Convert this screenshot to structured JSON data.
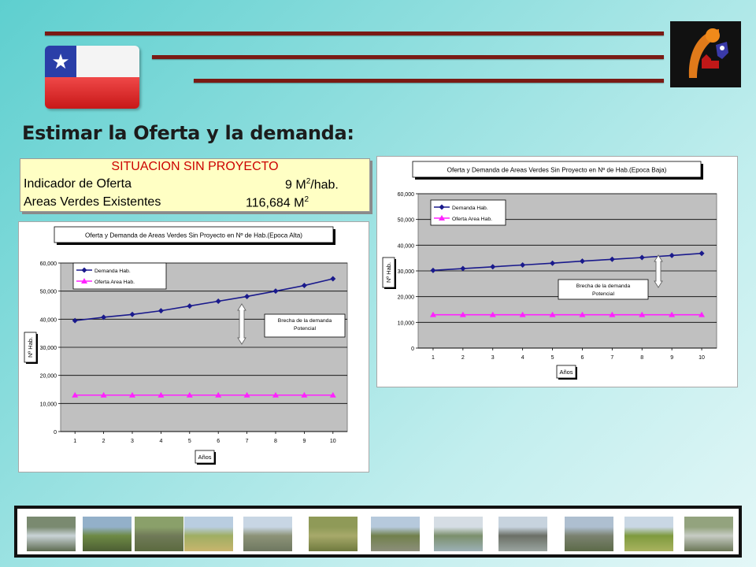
{
  "slide": {
    "title": "Estimar la Oferta y la demanda:",
    "flag": {
      "star": "★",
      "colors": [
        "#2a3ea8",
        "#f4f4f4",
        "#d82020"
      ]
    },
    "logo": {
      "icon": "institution-logo-icon"
    }
  },
  "info_box": {
    "heading": "SITUACION SIN PROYECTO",
    "rows": [
      {
        "label": "Indicador de Oferta",
        "value": "9",
        "unit_base": "M",
        "unit_sup": "2",
        "unit_suffix": "/hab."
      },
      {
        "label": "Areas Verdes Existentes",
        "value": "116,684",
        "unit_base": "M",
        "unit_sup": "2",
        "unit_suffix": ""
      }
    ]
  },
  "chart_data": [
    {
      "type": "line",
      "title": "Oferta y Demanda de Areas Verdes Sin Proyecto en Nº de Hab.(Epoca Alta)",
      "xlabel": "Años",
      "ylabel": "Nº Hab.",
      "x": [
        1,
        2,
        3,
        4,
        5,
        6,
        7,
        8,
        9,
        10
      ],
      "ylim": [
        0,
        60000
      ],
      "yticks": [
        "0",
        "10,000",
        "20,000",
        "30,000",
        "40,000",
        "50,000",
        "60,000"
      ],
      "grid": true,
      "legend": "top-left",
      "annotation": [
        "Brecha de la demanda",
        "Potencial"
      ],
      "series": [
        {
          "name": "Demanda Hab.",
          "color": "#1a1a8c",
          "marker": "diamond",
          "values": [
            39500,
            40700,
            41700,
            43000,
            44700,
            46400,
            48100,
            50000,
            52000,
            54400
          ]
        },
        {
          "name": "Oferta Area Hab.",
          "color": "#ff22ff",
          "marker": "triangle",
          "values": [
            12964,
            12964,
            12964,
            12964,
            12964,
            12964,
            12964,
            12964,
            12964,
            12964
          ]
        }
      ]
    },
    {
      "type": "line",
      "title": "Oferta y Demanda de Areas Verdes Sin Proyecto en Nº de Hab.(Epoca Baja)",
      "xlabel": "Años",
      "ylabel": "Nº Hab.",
      "x": [
        1,
        2,
        3,
        4,
        5,
        6,
        7,
        8,
        9,
        10
      ],
      "ylim": [
        0,
        60000
      ],
      "yticks": [
        "0",
        "10,000",
        "20,000",
        "30,000",
        "40,000",
        "50,000",
        "60,000"
      ],
      "grid": true,
      "legend": "top-left",
      "annotation": [
        "Brecha de la demanda",
        "Potencial"
      ],
      "series": [
        {
          "name": "Demanda Hab.",
          "color": "#1a1a8c",
          "marker": "diamond",
          "values": [
            30200,
            30900,
            31600,
            32300,
            33000,
            33800,
            34500,
            35200,
            36000,
            36800
          ]
        },
        {
          "name": "Oferta Area Hab.",
          "color": "#ff22ff",
          "marker": "triangle",
          "values": [
            12964,
            12964,
            12964,
            12964,
            12964,
            12964,
            12964,
            12964,
            12964,
            12964
          ]
        }
      ]
    }
  ],
  "photo_strip": [
    {
      "icon": "river-photo-icon",
      "colors": [
        "#7a8a70",
        "#c9d3d6",
        "#5d6b50"
      ]
    },
    {
      "icon": "trees-photo-icon",
      "colors": [
        "#93b0c9",
        "#6e8a45",
        "#4c5e33"
      ]
    },
    {
      "icon": "canal-photo-icon",
      "colors": [
        "#8aa06a",
        "#707a58",
        "#5b6a3f"
      ]
    },
    {
      "icon": "path-photo-icon",
      "colors": [
        "#b9cde0",
        "#9fae63",
        "#c8b56d"
      ]
    },
    {
      "icon": "field-photo-icon",
      "colors": [
        "#c8d6e4",
        "#8d9378",
        "#6e7760"
      ]
    },
    {
      "icon": "grass-photo-icon",
      "colors": [
        "#8f9a58",
        "#a7a96a",
        "#6f7a3e"
      ]
    },
    {
      "icon": "riverbank-photo-icon",
      "colors": [
        "#b6c9dc",
        "#71804c",
        "#8c8f7b"
      ]
    },
    {
      "icon": "river-bend-photo-icon",
      "colors": [
        "#d5dde4",
        "#7b8f6c",
        "#9cb1b6"
      ]
    },
    {
      "icon": "bridge-photo-icon",
      "colors": [
        "#c7d3de",
        "#6b6f66",
        "#9aa5a0"
      ]
    },
    {
      "icon": "debris-photo-icon",
      "colors": [
        "#aebfd0",
        "#7b8270",
        "#5c6a48"
      ]
    },
    {
      "icon": "willow-photo-icon",
      "colors": [
        "#c9d7e4",
        "#7e9a3e",
        "#a9b35f"
      ]
    },
    {
      "icon": "rocky-river-photo-icon",
      "colors": [
        "#93a37e",
        "#c7ccc4",
        "#6a7656"
      ]
    },
    {
      "icon": "open-river-photo-icon",
      "colors": [
        "#c5d3e0",
        "#8b9a6c",
        "#b1b8a9"
      ]
    }
  ]
}
